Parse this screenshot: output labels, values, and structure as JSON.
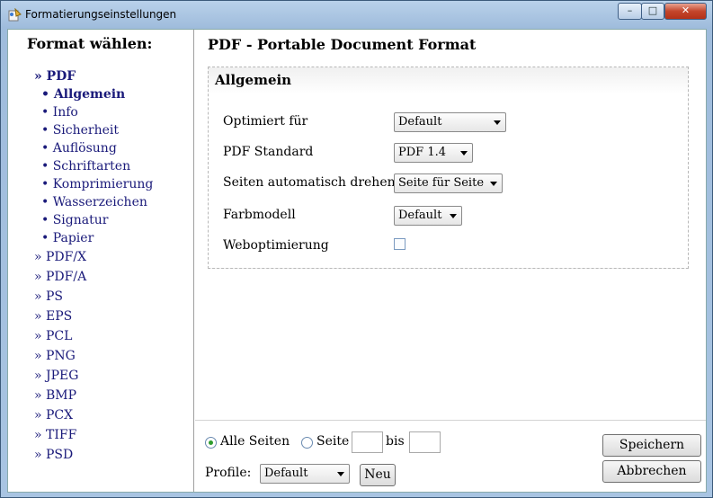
{
  "window": {
    "title": "Formatierungseinstellungen",
    "controls": [
      "–",
      "□",
      "✕"
    ]
  },
  "sidebar": {
    "title": "Format wählen:",
    "pdf_label": "» PDF",
    "pdf_sub": [
      "• Allgemein",
      "• Info",
      "• Sicherheit",
      "• Auflösung",
      "• Schriftarten",
      "• Komprimierung",
      "• Wasserzeichen",
      "• Signatur",
      "• Papier"
    ],
    "formats": [
      "» PDF/X",
      "» PDF/A",
      "» PS",
      "» EPS",
      "» PCL",
      "» PNG",
      "» JPEG",
      "» BMP",
      "» PCX",
      "» TIFF",
      "» PSD"
    ]
  },
  "main": {
    "title": "PDF - Portable Document Format",
    "panel_title": "Allgemein",
    "rows": {
      "optimiert": {
        "label": "Optimiert für",
        "value": "Default"
      },
      "standard": {
        "label": "PDF Standard",
        "value": "PDF 1.4"
      },
      "drehen": {
        "label": "Seiten automatisch drehen",
        "value": "Seite für Seite"
      },
      "farbmodell": {
        "label": "Farbmodell",
        "value": "Default"
      },
      "weboptimierung": {
        "label": "Weboptimierung",
        "checked": false
      }
    }
  },
  "bottom": {
    "alle_seiten": "Alle Seiten",
    "seite": "Seite",
    "bis": "bis",
    "from_value": "",
    "to_value": "",
    "profile_label": "Profile:",
    "profile_value": "Default",
    "neu": "Neu",
    "speichern": "Speichern",
    "abbrechen": "Abbrechen"
  }
}
